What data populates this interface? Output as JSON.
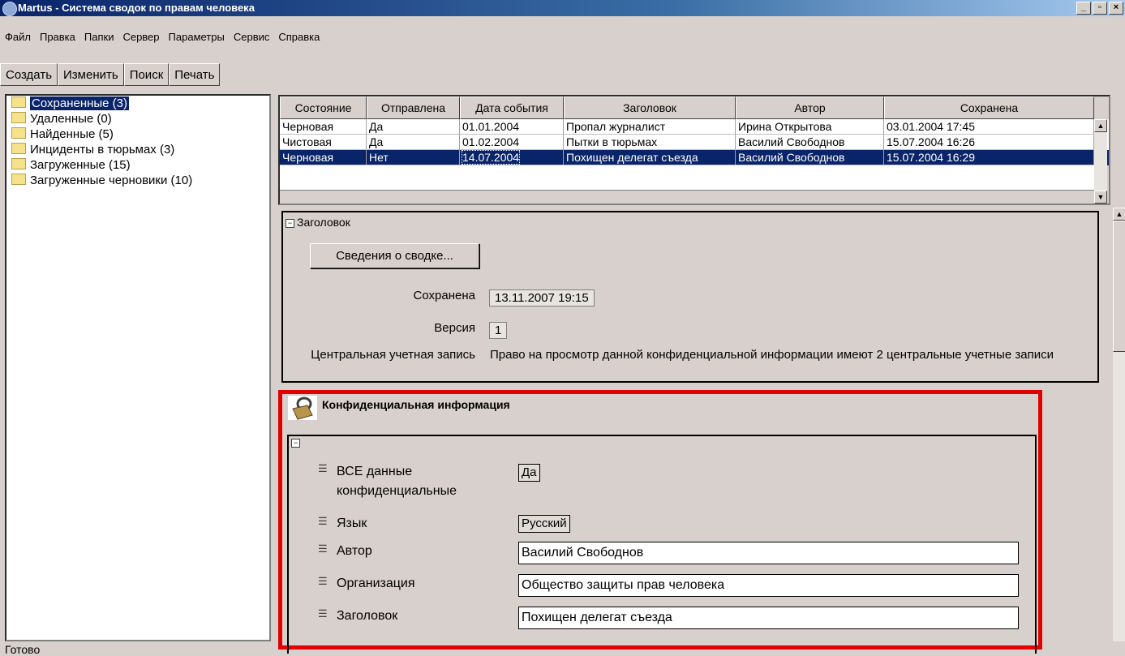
{
  "window": {
    "title": "Martus - Система сводок по правам человека",
    "buttons": {
      "minimize": "_",
      "maximize": "▫",
      "close": "×"
    }
  },
  "menu": [
    "Файл",
    "Правка",
    "Папки",
    "Сервер",
    "Параметры",
    "Сервис",
    "Справка"
  ],
  "toolbar": [
    "Создать",
    "Изменить",
    "Поиск",
    "Печать"
  ],
  "folders": [
    {
      "label": "Сохраненные (3)",
      "selected": true
    },
    {
      "label": "Удаленные (0)",
      "selected": false
    },
    {
      "label": "Найденные (5)",
      "selected": false
    },
    {
      "label": "Инциденты в тюрьмах (3)",
      "selected": false
    },
    {
      "label": "Загруженные (15)",
      "selected": false
    },
    {
      "label": "Загруженные черновики (10)",
      "selected": false
    }
  ],
  "table": {
    "headers": [
      "Состояние",
      "Отправлена",
      "Дата события",
      "Заголовок",
      "Автор",
      "Сохранена"
    ],
    "rows": [
      [
        "Черновая",
        "Да",
        "01.01.2004",
        "Пропал журналист",
        "Ирина Открытова",
        "03.01.2004 17:45"
      ],
      [
        "Чистовая",
        "Да",
        "01.02.2004",
        "Пытки в тюрьмах",
        "Василий Свободнов",
        "15.07.2004 16:26"
      ],
      [
        "Черновая",
        "Нет",
        "14.07.2004",
        "Похищен делегат съезда",
        "Василий Свободнов",
        "15.07.2004 16:29"
      ]
    ],
    "selected_row": 2
  },
  "header_section": {
    "title": "Заголовок",
    "collapse": "−",
    "details_button": "Сведения о сводке...",
    "saved_label": "Сохранена",
    "saved_value": "13.11.2007 19:15",
    "version_label": "Версия",
    "version_value": "1",
    "hq_label": "Центральная учетная запись",
    "hq_value": "Право на просмотр данной конфиденциальной информации имеют 2 центральные учетные записи"
  },
  "private_section": {
    "title": "Конфиденциальная информация",
    "collapse": "−",
    "fields": [
      {
        "label": "ВСЕ данные конфиденциальные",
        "value": "Да",
        "kind": "chip"
      },
      {
        "label": "Язык",
        "value": "Русский",
        "kind": "chip"
      },
      {
        "label": "Автор",
        "value": "Василий Свободнов",
        "kind": "text"
      },
      {
        "label": "Организация",
        "value": "Общество защиты прав человека",
        "kind": "text"
      },
      {
        "label": "Заголовок",
        "value": "Похищен делегат съезда",
        "kind": "text"
      }
    ]
  },
  "status": "Готово"
}
